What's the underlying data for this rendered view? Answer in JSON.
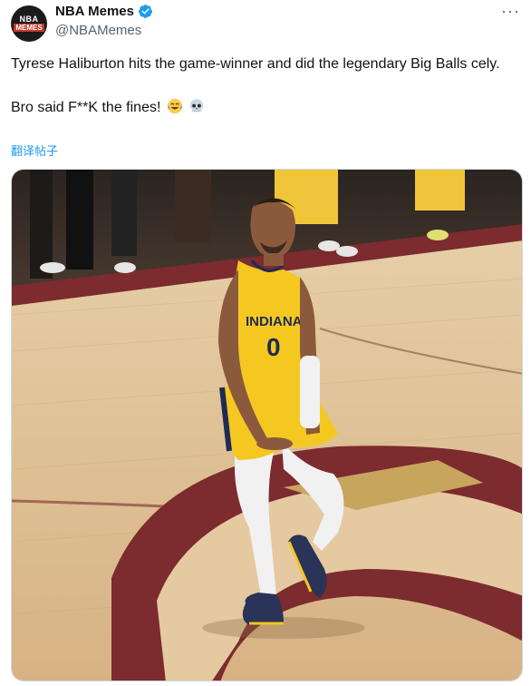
{
  "author": {
    "avatar_text_top": "NBA",
    "avatar_text_bottom": "MEMES",
    "display_name": "NBA Memes",
    "handle": "@NBAMemes",
    "verified": true
  },
  "menu": {
    "more_label": "···"
  },
  "tweet": {
    "line1": "Tyrese Haliburton hits the game-winner and did the legendary Big Balls cely.",
    "line2": "Bro said F**K the fines!",
    "emojis": [
      "face-with-tears-of-joy",
      "skull"
    ]
  },
  "translate_label": "翻译帖子",
  "media": {
    "jersey_text": "INDIANA",
    "jersey_number": "0"
  },
  "colors": {
    "link": "#1d9bf0",
    "verified": "#1d9bf0",
    "jersey_yellow": "#f4c821",
    "court_wood": "#d9b98e",
    "court_maroon": "#7c2b2e",
    "court_gold": "#c8a55d"
  }
}
